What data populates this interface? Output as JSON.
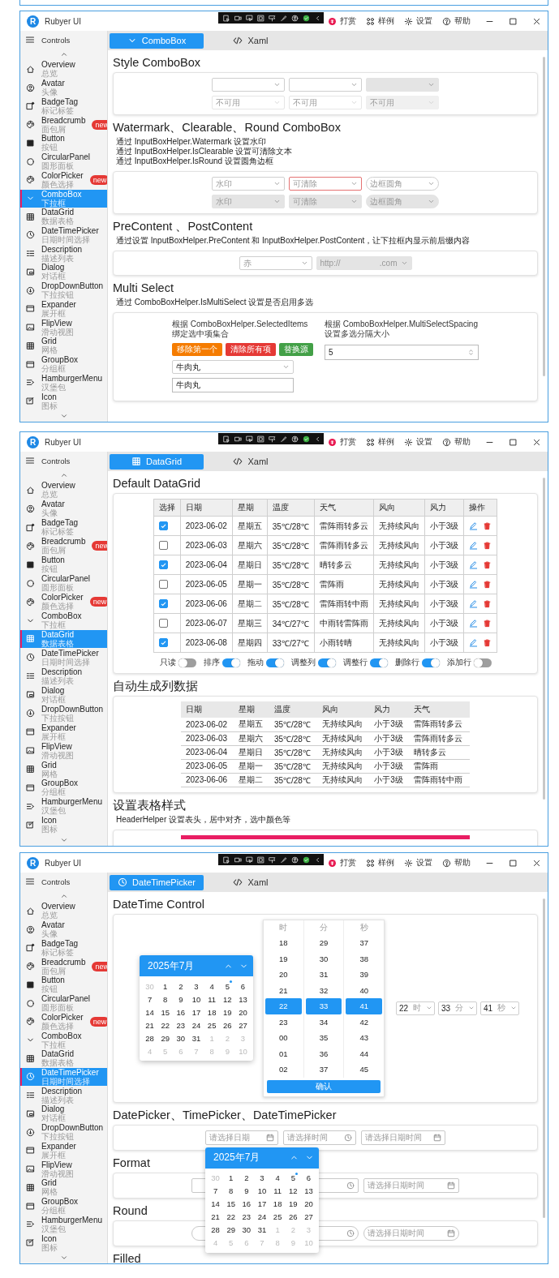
{
  "windows": [
    {
      "logo": "R",
      "title": "Rubyer UI",
      "title_actions": [
        {
          "label": "打赏",
          "kind": "reward"
        },
        {
          "label": "样例",
          "kind": "samples"
        },
        {
          "label": "设置",
          "kind": "settings"
        },
        {
          "label": "帮助",
          "kind": "help"
        }
      ],
      "nav_title": "Controls",
      "sidebar": [
        {
          "name": "Overview",
          "subtitle": "总览",
          "kind": "home",
          "selected": false
        },
        {
          "name": "Avatar",
          "subtitle": "头像",
          "kind": "avatar",
          "selected": false
        },
        {
          "name": "BadgeTag",
          "subtitle": "标记标签",
          "kind": "badge",
          "selected": false
        },
        {
          "name": "Breadcrumb",
          "subtitle": "面包屑",
          "kind": "palette",
          "badge": "new",
          "selected": false
        },
        {
          "name": "Button",
          "subtitle": "按钮",
          "kind": "square",
          "selected": false
        },
        {
          "name": "CircularPanel",
          "subtitle": "圆形面板",
          "kind": "circle",
          "selected": false
        },
        {
          "name": "ColorPicker",
          "subtitle": "颜色选择",
          "kind": "palette",
          "badge": "new",
          "selected": false
        },
        {
          "name": "ComboBox",
          "subtitle": "下拉框",
          "kind": "chevron",
          "selected": true
        },
        {
          "name": "DataGrid",
          "subtitle": "数据表格",
          "kind": "grid",
          "selected": false
        },
        {
          "name": "DateTimePicker",
          "subtitle": "日期时间选择",
          "kind": "clock",
          "selected": false
        },
        {
          "name": "Description",
          "subtitle": "描述列表",
          "kind": "list",
          "selected": false
        },
        {
          "name": "Dialog",
          "subtitle": "对话框",
          "kind": "dialog",
          "selected": false
        },
        {
          "name": "DropDownButton",
          "subtitle": "下拉按钮",
          "kind": "dropdown",
          "selected": false
        },
        {
          "name": "Expander",
          "subtitle": "展开框",
          "kind": "panel",
          "selected": false
        },
        {
          "name": "FlipView",
          "subtitle": "滑动视图",
          "kind": "image",
          "selected": false
        },
        {
          "name": "Grid",
          "subtitle": "网格",
          "kind": "grid",
          "selected": false
        },
        {
          "name": "GroupBox",
          "subtitle": "分组框",
          "kind": "panel",
          "selected": false
        },
        {
          "name": "HamburgerMenu",
          "subtitle": "汉堡包",
          "kind": "menu",
          "selected": false
        },
        {
          "name": "Icon",
          "subtitle": "图标",
          "kind": "icon",
          "selected": false
        }
      ],
      "tabs": [
        {
          "label": "ComboBox",
          "kind": "chevron",
          "selected": true
        },
        {
          "label": "Xaml",
          "kind": "code",
          "selected": false
        }
      ],
      "sections": [
        {
          "kind": "combo_rows",
          "title": "Style ComboBox",
          "rows": [
            [
              {
                "kind": "outline",
                "disabled": false,
                "highlighted": false
              },
              {
                "kind": "outline",
                "disabled": false,
                "highlighted": false
              },
              {
                "kind": "filled",
                "disabled": false,
                "highlighted": false
              }
            ],
            [
              {
                "kind": "outline",
                "placeholder": "不可用",
                "disabled": true,
                "highlighted": false
              },
              {
                "kind": "outline",
                "placeholder": "不可用",
                "disabled": true,
                "highlighted": false
              },
              {
                "kind": "filled",
                "placeholder": "不可用",
                "disabled": true,
                "highlighted": false
              }
            ]
          ]
        },
        {
          "kind": "combo_rows",
          "title": "Watermark、Clearable、Round ComboBox",
          "description": [
            "通过 InputBoxHelper.Watermark 设置水印",
            "通过 InputBoxHelper.IsClearable 设置可清除文本",
            "通过 InputBoxHelper.IsRound 设置圆角边框"
          ],
          "rows": [
            [
              {
                "kind": "outline",
                "placeholder": "水印",
                "disabled": false,
                "highlighted": false
              },
              {
                "kind": "outline",
                "placeholder": "可清除",
                "disabled": false,
                "highlighted": true
              },
              {
                "kind": "round",
                "placeholder": "边框圆角",
                "disabled": false,
                "highlighted": false
              }
            ],
            [
              {
                "kind": "filled",
                "placeholder": "水印",
                "disabled": false,
                "highlighted": false
              },
              {
                "kind": "filled",
                "placeholder": "可清除",
                "disabled": false,
                "highlighted": false
              },
              {
                "kind": "filled_round",
                "placeholder": "边框圆角",
                "disabled": false,
                "highlighted": false
              }
            ]
          ]
        },
        {
          "kind": "combo_rows",
          "title": "PreContent 、PostContent",
          "description": [
            "通过设置 InputBoxHelper.PreContent 和 InputBoxHelper.PostContent，让下拉框内显示前后缀内容"
          ],
          "rows": [
            [
              {
                "kind": "outline",
                "pre_content": "赤",
                "disabled": false,
                "highlighted": false
              },
              {
                "kind": "filled",
                "pre_content": "http://",
                "post_content": ".com",
                "disabled": false,
                "highlighted": false
              }
            ]
          ]
        },
        {
          "kind": "multi_select",
          "title": "Multi Select",
          "description": [
            "通过 ComboBoxHelper.IsMultiSelect 设置是否启用多选"
          ],
          "left_label": "根据 ComboBoxHelper.SelectedItems\n绑定选中项集合",
          "buttons": [
            {
              "label": "移除第一个",
              "color": "#f57c00"
            },
            {
              "label": "清除所有项",
              "color": "#e53935"
            },
            {
              "label": "替换源",
              "color": "#43a047"
            }
          ],
          "combo": {
            "kind": "outline",
            "value": "牛肉丸",
            "disabled": false,
            "highlighted": false
          },
          "text_field": {
            "value": "牛肉丸"
          },
          "right_label": "根据 ComboBoxHelper.MultiSelectSpacing\n设置多选分隔大小",
          "number_field": {
            "value": "5"
          }
        }
      ]
    },
    {
      "logo": "R",
      "title": "Rubyer UI",
      "title_actions": [
        {
          "label": "打赏",
          "kind": "reward"
        },
        {
          "label": "样例",
          "kind": "samples"
        },
        {
          "label": "设置",
          "kind": "settings"
        },
        {
          "label": "帮助",
          "kind": "help"
        }
      ],
      "nav_title": "Controls",
      "sidebar": [
        {
          "name": "Overview",
          "subtitle": "总览",
          "kind": "home",
          "selected": false
        },
        {
          "name": "Avatar",
          "subtitle": "头像",
          "kind": "avatar",
          "selected": false
        },
        {
          "name": "BadgeTag",
          "subtitle": "标记标签",
          "kind": "badge",
          "selected": false
        },
        {
          "name": "Breadcrumb",
          "subtitle": "面包屑",
          "kind": "palette",
          "badge": "new",
          "selected": false
        },
        {
          "name": "Button",
          "subtitle": "按钮",
          "kind": "square",
          "selected": false
        },
        {
          "name": "CircularPanel",
          "subtitle": "圆形面板",
          "kind": "circle",
          "selected": false
        },
        {
          "name": "ColorPicker",
          "subtitle": "颜色选择",
          "kind": "palette",
          "badge": "new",
          "selected": false
        },
        {
          "name": "ComboBox",
          "subtitle": "下拉框",
          "kind": "chevron",
          "selected": false
        },
        {
          "name": "DataGrid",
          "subtitle": "数据表格",
          "kind": "grid",
          "selected": true
        },
        {
          "name": "DateTimePicker",
          "subtitle": "日期时间选择",
          "kind": "clock",
          "selected": false
        },
        {
          "name": "Description",
          "subtitle": "描述列表",
          "kind": "list",
          "selected": false
        },
        {
          "name": "Dialog",
          "subtitle": "对话框",
          "kind": "dialog",
          "selected": false
        },
        {
          "name": "DropDownButton",
          "subtitle": "下拉按钮",
          "kind": "dropdown",
          "selected": false
        },
        {
          "name": "Expander",
          "subtitle": "展开框",
          "kind": "panel",
          "selected": false
        },
        {
          "name": "FlipView",
          "subtitle": "滑动视图",
          "kind": "image",
          "selected": false
        },
        {
          "name": "Grid",
          "subtitle": "网格",
          "kind": "grid",
          "selected": false
        },
        {
          "name": "GroupBox",
          "subtitle": "分组框",
          "kind": "panel",
          "selected": false
        },
        {
          "name": "HamburgerMenu",
          "subtitle": "汉堡包",
          "kind": "menu",
          "selected": false
        },
        {
          "name": "Icon",
          "subtitle": "图标",
          "kind": "icon",
          "selected": false
        }
      ],
      "tabs": [
        {
          "label": "DataGrid",
          "kind": "grid",
          "selected": true
        },
        {
          "label": "Xaml",
          "kind": "code",
          "selected": false
        }
      ],
      "sections": [
        {
          "kind": "datagrid",
          "title": "Default DataGrid",
          "checkbox_column": "选择",
          "columns": [
            "日期",
            "星期",
            "温度",
            "天气",
            "风向",
            "风力"
          ],
          "actions_column": "操作",
          "rows": [
            {
              "checked": true,
              "cells": [
                "2023-06-02",
                "星期五",
                "35℃/28℃",
                "雷阵雨转多云",
                "无持续风向",
                "小于3级"
              ]
            },
            {
              "checked": false,
              "cells": [
                "2023-06-03",
                "星期六",
                "35℃/28℃",
                "雷阵雨转多云",
                "无持续风向",
                "小于3级"
              ]
            },
            {
              "checked": true,
              "cells": [
                "2023-06-04",
                "星期日",
                "35℃/28℃",
                "晴转多云",
                "无持续风向",
                "小于3级"
              ]
            },
            {
              "checked": false,
              "cells": [
                "2023-06-05",
                "星期一",
                "35℃/28℃",
                "雷阵雨",
                "无持续风向",
                "小于3级"
              ]
            },
            {
              "checked": true,
              "cells": [
                "2023-06-06",
                "星期二",
                "35℃/28℃",
                "雷阵雨转中雨",
                "无持续风向",
                "小于3级"
              ]
            },
            {
              "checked": false,
              "cells": [
                "2023-06-07",
                "星期三",
                "34℃/27℃",
                "中雨转雷阵雨",
                "无持续风向",
                "小于3级"
              ]
            },
            {
              "checked": true,
              "cells": [
                "2023-06-08",
                "星期四",
                "33℃/27℃",
                "小雨转晴",
                "无持续风向",
                "小于3级"
              ]
            }
          ],
          "toggles": [
            {
              "label": "只读",
              "on": false
            },
            {
              "label": "排序",
              "on": true
            },
            {
              "label": "拖动",
              "on": true
            },
            {
              "label": "调整列",
              "on": true
            },
            {
              "label": "调整行",
              "on": true
            },
            {
              "label": "删除行",
              "on": true
            },
            {
              "label": "添加行",
              "on": false
            }
          ]
        },
        {
          "kind": "table",
          "title": "自动生成列数据",
          "columns": [
            "日期",
            "星期",
            "温度",
            "风向",
            "风力",
            "天气"
          ],
          "rows": [
            [
              "2023-06-02",
              "星期五",
              "35℃/28℃",
              "无持续风向",
              "小于3级",
              "雷阵雨转多云"
            ],
            [
              "2023-06-03",
              "星期六",
              "35℃/28℃",
              "无持续风向",
              "小于3级",
              "雷阵雨转多云"
            ],
            [
              "2023-06-04",
              "星期日",
              "35℃/28℃",
              "无持续风向",
              "小于3级",
              "晴转多云"
            ],
            [
              "2023-06-05",
              "星期一",
              "35℃/28℃",
              "无持续风向",
              "小于3级",
              "雷阵雨"
            ],
            [
              "2023-06-06",
              "星期二",
              "35℃/28℃",
              "无持续风向",
              "小于3级",
              "雷阵雨转中雨"
            ]
          ]
        },
        {
          "kind": "styled_table",
          "title": "设置表格样式",
          "description": [
            "HeaderHelper 设置表头，居中对齐，选中颜色等"
          ]
        }
      ]
    },
    {
      "logo": "R",
      "title": "Rubyer UI",
      "title_actions": [
        {
          "label": "打赏",
          "kind": "reward"
        },
        {
          "label": "样例",
          "kind": "samples"
        },
        {
          "label": "设置",
          "kind": "settings"
        },
        {
          "label": "帮助",
          "kind": "help"
        }
      ],
      "nav_title": "Controls",
      "sidebar": [
        {
          "name": "Overview",
          "subtitle": "总览",
          "kind": "home",
          "selected": false
        },
        {
          "name": "Avatar",
          "subtitle": "头像",
          "kind": "avatar",
          "selected": false
        },
        {
          "name": "BadgeTag",
          "subtitle": "标记标签",
          "kind": "badge",
          "selected": false
        },
        {
          "name": "Breadcrumb",
          "subtitle": "面包屑",
          "kind": "palette",
          "badge": "new",
          "selected": false
        },
        {
          "name": "Button",
          "subtitle": "按钮",
          "kind": "square",
          "selected": false
        },
        {
          "name": "CircularPanel",
          "subtitle": "圆形面板",
          "kind": "circle",
          "selected": false
        },
        {
          "name": "ColorPicker",
          "subtitle": "颜色选择",
          "kind": "palette",
          "badge": "new",
          "selected": false
        },
        {
          "name": "ComboBox",
          "subtitle": "下拉框",
          "kind": "chevron",
          "selected": false
        },
        {
          "name": "DataGrid",
          "subtitle": "数据表格",
          "kind": "grid",
          "selected": false
        },
        {
          "name": "DateTimePicker",
          "subtitle": "日期时间选择",
          "kind": "clock",
          "selected": true
        },
        {
          "name": "Description",
          "subtitle": "描述列表",
          "kind": "list",
          "selected": false
        },
        {
          "name": "Dialog",
          "subtitle": "对话框",
          "kind": "dialog",
          "selected": false
        },
        {
          "name": "DropDownButton",
          "subtitle": "下拉按钮",
          "kind": "dropdown",
          "selected": false
        },
        {
          "name": "Expander",
          "subtitle": "展开框",
          "kind": "panel",
          "selected": false
        },
        {
          "name": "FlipView",
          "subtitle": "滑动视图",
          "kind": "image",
          "selected": false
        },
        {
          "name": "Grid",
          "subtitle": "网格",
          "kind": "grid",
          "selected": false
        },
        {
          "name": "GroupBox",
          "subtitle": "分组框",
          "kind": "panel",
          "selected": false
        },
        {
          "name": "HamburgerMenu",
          "subtitle": "汉堡包",
          "kind": "menu",
          "selected": false
        },
        {
          "name": "Icon",
          "subtitle": "图标",
          "kind": "icon",
          "selected": false
        }
      ],
      "tabs": [
        {
          "label": "DateTimePicker",
          "kind": "clock",
          "selected": true
        },
        {
          "label": "Xaml",
          "kind": "code",
          "selected": false
        }
      ],
      "sections": [
        {
          "kind": "datetime_control",
          "title": "DateTime Control",
          "calendar": {
            "title": "2025年7月",
            "leading": [
              "30"
            ],
            "days": [
              {
                "label": "1",
                "today": false
              },
              {
                "label": "2",
                "today": false
              },
              {
                "label": "3",
                "today": false
              },
              {
                "label": "4",
                "today": false
              },
              {
                "label": "5",
                "today": true
              },
              {
                "label": "6",
                "today": false
              },
              {
                "label": "7",
                "today": false
              },
              {
                "label": "8",
                "today": false
              },
              {
                "label": "9",
                "today": false
              },
              {
                "label": "10",
                "today": false
              },
              {
                "label": "11",
                "today": false
              },
              {
                "label": "12",
                "today": false
              },
              {
                "label": "13",
                "today": false
              },
              {
                "label": "14",
                "today": false
              },
              {
                "label": "15",
                "today": false
              },
              {
                "label": "16",
                "today": false
              },
              {
                "label": "17",
                "today": false
              },
              {
                "label": "18",
                "today": false
              },
              {
                "label": "19",
                "today": false
              },
              {
                "label": "20",
                "today": false
              },
              {
                "label": "21",
                "today": false
              },
              {
                "label": "22",
                "today": false
              },
              {
                "label": "23",
                "today": false
              },
              {
                "label": "24",
                "today": false
              },
              {
                "label": "25",
                "today": false
              },
              {
                "label": "26",
                "today": false
              },
              {
                "label": "27",
                "today": false
              },
              {
                "label": "28",
                "today": false
              },
              {
                "label": "29",
                "today": false
              },
              {
                "label": "30",
                "today": false
              },
              {
                "label": "31",
                "today": false
              }
            ],
            "trailing": [
              "1",
              "2",
              "3",
              "4",
              "5",
              "6",
              "7",
              "8",
              "9",
              "10"
            ]
          },
          "time_picker": {
            "columns": [
              {
                "header": "时",
                "options": [
                  {
                    "label": "18",
                    "selected": false
                  },
                  {
                    "label": "19",
                    "selected": false
                  },
                  {
                    "label": "20",
                    "selected": false
                  },
                  {
                    "label": "21",
                    "selected": false
                  },
                  {
                    "label": "22",
                    "selected": true
                  },
                  {
                    "label": "23",
                    "selected": false
                  },
                  {
                    "label": "00",
                    "selected": false
                  },
                  {
                    "label": "01",
                    "selected": false
                  },
                  {
                    "label": "02",
                    "selected": false
                  }
                ]
              },
              {
                "header": "分",
                "options": [
                  {
                    "label": "29",
                    "selected": false
                  },
                  {
                    "label": "30",
                    "selected": false
                  },
                  {
                    "label": "31",
                    "selected": false
                  },
                  {
                    "label": "32",
                    "selected": false
                  },
                  {
                    "label": "33",
                    "selected": true
                  },
                  {
                    "label": "34",
                    "selected": false
                  },
                  {
                    "label": "35",
                    "selected": false
                  },
                  {
                    "label": "36",
                    "selected": false
                  },
                  {
                    "label": "37",
                    "selected": false
                  }
                ]
              },
              {
                "header": "秒",
                "options": [
                  {
                    "label": "37",
                    "selected": false
                  },
                  {
                    "label": "38",
                    "selected": false
                  },
                  {
                    "label": "39",
                    "selected": false
                  },
                  {
                    "label": "40",
                    "selected": false
                  },
                  {
                    "label": "41",
                    "selected": true
                  },
                  {
                    "label": "42",
                    "selected": false
                  },
                  {
                    "label": "43",
                    "selected": false
                  },
                  {
                    "label": "44",
                    "selected": false
                  },
                  {
                    "label": "45",
                    "selected": false
                  }
                ]
              }
            ],
            "confirm": "确认"
          },
          "time_combos": [
            {
              "value": "22",
              "unit": "时"
            },
            {
              "value": "33",
              "unit": "分"
            },
            {
              "value": "41",
              "unit": "秒"
            }
          ]
        },
        {
          "kind": "pickers",
          "title": "DatePicker、TimePicker、DateTimePicker",
          "round": false,
          "fields": [
            {
              "kind": "date",
              "placeholder": "请选择日期"
            },
            {
              "kind": "time",
              "placeholder": "请选择时间"
            },
            {
              "kind": "datetime",
              "placeholder": "请选择日期时间"
            }
          ],
          "popup_calendar": {
            "title": "2025年7月",
            "leading": [
              "30"
            ],
            "days": [
              {
                "label": "1",
                "today": false
              },
              {
                "label": "2",
                "today": false
              },
              {
                "label": "3",
                "today": false
              },
              {
                "label": "4",
                "today": false
              },
              {
                "label": "5",
                "today": true
              },
              {
                "label": "6",
                "today": false
              },
              {
                "label": "7",
                "today": false
              },
              {
                "label": "8",
                "today": false
              },
              {
                "label": "9",
                "today": false
              },
              {
                "label": "10",
                "today": false
              },
              {
                "label": "11",
                "today": false
              },
              {
                "label": "12",
                "today": false
              },
              {
                "label": "13",
                "today": false
              },
              {
                "label": "14",
                "today": false
              },
              {
                "label": "15",
                "today": false
              },
              {
                "label": "16",
                "today": false
              },
              {
                "label": "17",
                "today": false
              },
              {
                "label": "18",
                "today": false
              },
              {
                "label": "19",
                "today": false
              },
              {
                "label": "20",
                "today": false
              },
              {
                "label": "21",
                "today": false
              },
              {
                "label": "22",
                "today": false
              },
              {
                "label": "23",
                "today": false
              },
              {
                "label": "24",
                "today": false
              },
              {
                "label": "25",
                "today": false
              },
              {
                "label": "26",
                "today": false
              },
              {
                "label": "27",
                "today": false
              },
              {
                "label": "28",
                "today": false
              },
              {
                "label": "29",
                "today": false
              },
              {
                "label": "30",
                "today": false
              },
              {
                "label": "31",
                "today": false
              }
            ],
            "trailing": [
              "1",
              "2",
              "3",
              "4",
              "5",
              "6",
              "7",
              "8",
              "9",
              "10"
            ]
          }
        },
        {
          "kind": "pickers",
          "title": "Format",
          "round": false,
          "fields": [
            {
              "kind": "date"
            },
            {
              "kind": "time"
            },
            {
              "kind": "datetime",
              "placeholder": "请选择日期时间"
            }
          ]
        },
        {
          "kind": "pickers",
          "title": "Round",
          "round": true,
          "fields": [
            {
              "kind": "date"
            },
            {
              "kind": "time"
            },
            {
              "kind": "datetime",
              "placeholder": "请选择日期时间"
            }
          ]
        },
        {
          "kind": "pickers",
          "title": "Filled"
        }
      ]
    }
  ]
}
